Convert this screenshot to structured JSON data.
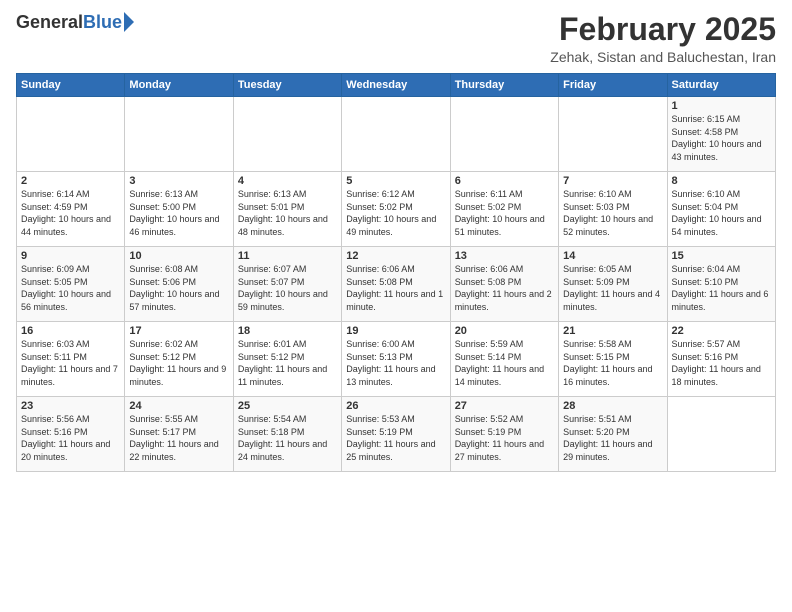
{
  "header": {
    "logo_general": "General",
    "logo_blue": "Blue",
    "title": "February 2025",
    "subtitle": "Zehak, Sistan and Baluchestan, Iran"
  },
  "weekdays": [
    "Sunday",
    "Monday",
    "Tuesday",
    "Wednesday",
    "Thursday",
    "Friday",
    "Saturday"
  ],
  "weeks": [
    [
      {
        "day": "",
        "info": ""
      },
      {
        "day": "",
        "info": ""
      },
      {
        "day": "",
        "info": ""
      },
      {
        "day": "",
        "info": ""
      },
      {
        "day": "",
        "info": ""
      },
      {
        "day": "",
        "info": ""
      },
      {
        "day": "1",
        "info": "Sunrise: 6:15 AM\nSunset: 4:58 PM\nDaylight: 10 hours and 43 minutes."
      }
    ],
    [
      {
        "day": "2",
        "info": "Sunrise: 6:14 AM\nSunset: 4:59 PM\nDaylight: 10 hours and 44 minutes."
      },
      {
        "day": "3",
        "info": "Sunrise: 6:13 AM\nSunset: 5:00 PM\nDaylight: 10 hours and 46 minutes."
      },
      {
        "day": "4",
        "info": "Sunrise: 6:13 AM\nSunset: 5:01 PM\nDaylight: 10 hours and 48 minutes."
      },
      {
        "day": "5",
        "info": "Sunrise: 6:12 AM\nSunset: 5:02 PM\nDaylight: 10 hours and 49 minutes."
      },
      {
        "day": "6",
        "info": "Sunrise: 6:11 AM\nSunset: 5:02 PM\nDaylight: 10 hours and 51 minutes."
      },
      {
        "day": "7",
        "info": "Sunrise: 6:10 AM\nSunset: 5:03 PM\nDaylight: 10 hours and 52 minutes."
      },
      {
        "day": "8",
        "info": "Sunrise: 6:10 AM\nSunset: 5:04 PM\nDaylight: 10 hours and 54 minutes."
      }
    ],
    [
      {
        "day": "9",
        "info": "Sunrise: 6:09 AM\nSunset: 5:05 PM\nDaylight: 10 hours and 56 minutes."
      },
      {
        "day": "10",
        "info": "Sunrise: 6:08 AM\nSunset: 5:06 PM\nDaylight: 10 hours and 57 minutes."
      },
      {
        "day": "11",
        "info": "Sunrise: 6:07 AM\nSunset: 5:07 PM\nDaylight: 10 hours and 59 minutes."
      },
      {
        "day": "12",
        "info": "Sunrise: 6:06 AM\nSunset: 5:08 PM\nDaylight: 11 hours and 1 minute."
      },
      {
        "day": "13",
        "info": "Sunrise: 6:06 AM\nSunset: 5:08 PM\nDaylight: 11 hours and 2 minutes."
      },
      {
        "day": "14",
        "info": "Sunrise: 6:05 AM\nSunset: 5:09 PM\nDaylight: 11 hours and 4 minutes."
      },
      {
        "day": "15",
        "info": "Sunrise: 6:04 AM\nSunset: 5:10 PM\nDaylight: 11 hours and 6 minutes."
      }
    ],
    [
      {
        "day": "16",
        "info": "Sunrise: 6:03 AM\nSunset: 5:11 PM\nDaylight: 11 hours and 7 minutes."
      },
      {
        "day": "17",
        "info": "Sunrise: 6:02 AM\nSunset: 5:12 PM\nDaylight: 11 hours and 9 minutes."
      },
      {
        "day": "18",
        "info": "Sunrise: 6:01 AM\nSunset: 5:12 PM\nDaylight: 11 hours and 11 minutes."
      },
      {
        "day": "19",
        "info": "Sunrise: 6:00 AM\nSunset: 5:13 PM\nDaylight: 11 hours and 13 minutes."
      },
      {
        "day": "20",
        "info": "Sunrise: 5:59 AM\nSunset: 5:14 PM\nDaylight: 11 hours and 14 minutes."
      },
      {
        "day": "21",
        "info": "Sunrise: 5:58 AM\nSunset: 5:15 PM\nDaylight: 11 hours and 16 minutes."
      },
      {
        "day": "22",
        "info": "Sunrise: 5:57 AM\nSunset: 5:16 PM\nDaylight: 11 hours and 18 minutes."
      }
    ],
    [
      {
        "day": "23",
        "info": "Sunrise: 5:56 AM\nSunset: 5:16 PM\nDaylight: 11 hours and 20 minutes."
      },
      {
        "day": "24",
        "info": "Sunrise: 5:55 AM\nSunset: 5:17 PM\nDaylight: 11 hours and 22 minutes."
      },
      {
        "day": "25",
        "info": "Sunrise: 5:54 AM\nSunset: 5:18 PM\nDaylight: 11 hours and 24 minutes."
      },
      {
        "day": "26",
        "info": "Sunrise: 5:53 AM\nSunset: 5:19 PM\nDaylight: 11 hours and 25 minutes."
      },
      {
        "day": "27",
        "info": "Sunrise: 5:52 AM\nSunset: 5:19 PM\nDaylight: 11 hours and 27 minutes."
      },
      {
        "day": "28",
        "info": "Sunrise: 5:51 AM\nSunset: 5:20 PM\nDaylight: 11 hours and 29 minutes."
      },
      {
        "day": "",
        "info": ""
      }
    ]
  ]
}
